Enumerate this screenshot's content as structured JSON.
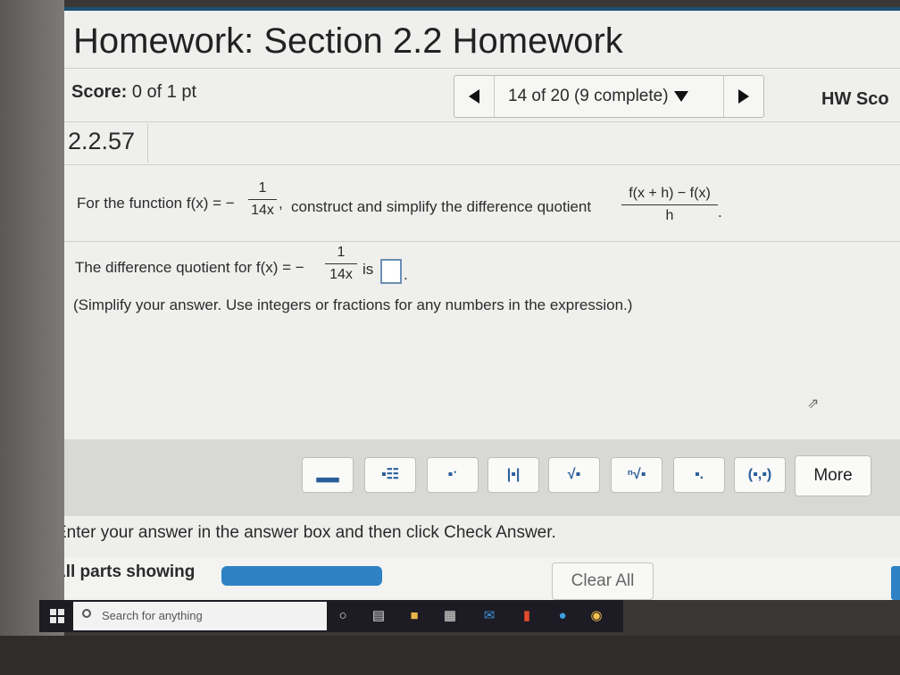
{
  "header": {
    "title": "Homework: Section 2.2 Homework",
    "score_label": "Score:",
    "score_value": "0 of 1 pt",
    "nav_position": "14 of 20 (9 complete)",
    "hw_score_label": "HW Sco"
  },
  "question": {
    "number": "2.2.57",
    "prompt_lead": "For the function f(x) = −",
    "func_num": "1",
    "func_den": "14x",
    "prompt_comma": ",",
    "prompt_mid": "construct and simplify the difference quotient",
    "dq_num": "f(x + h) − f(x)",
    "dq_den": "h",
    "prompt_end": ".",
    "answer_lead": "The difference quotient for f(x) = −",
    "answer_func_num": "1",
    "answer_func_den": "14x",
    "answer_is": "is",
    "answer_end": ".",
    "instruction": "(Simplify your answer. Use integers or fractions for any numbers in the expression.)"
  },
  "toolbar": {
    "buttons": [
      {
        "icon": "fraction-template-icon",
        "glyph": "▂▂"
      },
      {
        "icon": "mixed-number-template-icon",
        "glyph": "▪☷"
      },
      {
        "icon": "exponent-template-icon",
        "glyph": "▪ˑ"
      },
      {
        "icon": "absolute-value-template-icon",
        "glyph": "|▪|"
      },
      {
        "icon": "square-root-template-icon",
        "glyph": "√▪"
      },
      {
        "icon": "nth-root-template-icon",
        "glyph": "ⁿ√▪"
      },
      {
        "icon": "subscript-template-icon",
        "glyph": "▪."
      },
      {
        "icon": "ordered-pair-template-icon",
        "glyph": "(▪,▪)"
      }
    ],
    "more_label": "More"
  },
  "footer": {
    "message": "Enter your answer in the answer box and then click Check Answer.",
    "parts_label": "All parts showing",
    "progress_fraction": 1.0,
    "clear_all_label": "Clear All"
  },
  "taskbar": {
    "search_placeholder": "Search for anything"
  },
  "colors": {
    "accent": "#2e82c4",
    "title_bar": "#1b4f72"
  }
}
